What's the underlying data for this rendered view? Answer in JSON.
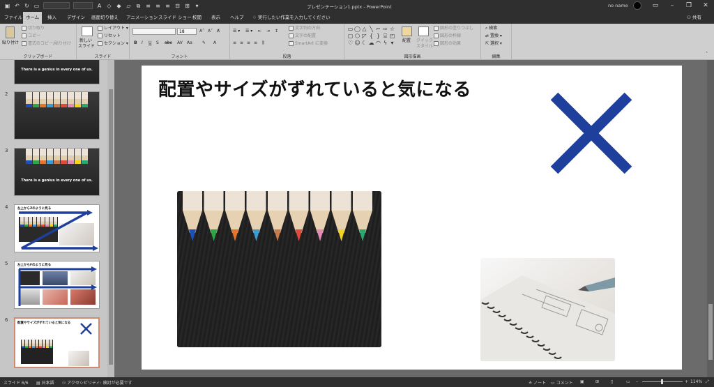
{
  "window": {
    "title": "プレゼンテーション1.pptx - PowerPoint",
    "user": "no name"
  },
  "tabs": [
    {
      "label": "ファイル",
      "active": false
    },
    {
      "label": "ホーム",
      "active": true
    },
    {
      "label": "挿入",
      "active": false
    },
    {
      "label": "デザイン",
      "active": false
    },
    {
      "label": "画面切り替え",
      "active": false
    },
    {
      "label": "アニメーション",
      "active": false
    },
    {
      "label": "スライド ショー",
      "active": false
    },
    {
      "label": "校閲",
      "active": false
    },
    {
      "label": "表示",
      "active": false
    },
    {
      "label": "ヘルプ",
      "active": false
    }
  ],
  "tell_me": "実行したい作業を入力してください",
  "share": "共有",
  "ribbon": {
    "clipboard": {
      "group_label": "クリップボード",
      "paste": "貼り付け",
      "cut": "切り取り",
      "copy": "コピー",
      "format_painter": "書式のコピー/貼り付け"
    },
    "slides": {
      "group_label": "スライド",
      "new_slide_line1": "新しい",
      "new_slide_line2": "スライド",
      "layout": "レイアウト",
      "reset": "リセット",
      "section": "セクション"
    },
    "font": {
      "group_label": "フォント",
      "size": "18",
      "bold": "B",
      "italic": "I",
      "underline": "U",
      "shadow": "S",
      "strike": "abc"
    },
    "paragraph": {
      "group_label": "段落",
      "text_direction": "文字列の方向",
      "align_text": "文字の配置",
      "smartart": "SmartArt に変換"
    },
    "drawing": {
      "group_label": "図形描画",
      "arrange": "配置",
      "quick_styles_line1": "クイック",
      "quick_styles_line2": "スタイル",
      "shape_fill": "図形の塗りつぶし",
      "shape_outline": "図形の枠線",
      "shape_effects": "図形の効果"
    },
    "editing": {
      "group_label": "編集",
      "find": "検索",
      "replace": "置換",
      "select": "選択"
    }
  },
  "thumbnails": [
    {
      "num": "",
      "caption": "There is a genius in every one of us."
    },
    {
      "num": "2",
      "caption": ""
    },
    {
      "num": "3",
      "caption": "There is a genius in every one of us."
    },
    {
      "num": "4",
      "caption": "左上からZのように見る"
    },
    {
      "num": "5",
      "caption": "左上からFのように見る"
    },
    {
      "num": "6",
      "caption": "配置やサイズがずれていると気になる"
    }
  ],
  "slide": {
    "title": "配置やサイズがずれていると気になる",
    "x_color": "#1e3f9c"
  },
  "status": {
    "slide_of": "スライド 6/6",
    "language": "日本語",
    "accessibility": "アクセシビリティ: 検討が必要です",
    "notes": "ノート",
    "comments": "コメント",
    "zoom": "114%"
  },
  "colors": {
    "ribbon_bg": "#cfcfcf",
    "titlebar_bg": "#2f2f2f",
    "pane_bg": "#c6c6c6",
    "editor_bg": "#6b6b6b",
    "accent_blue": "#1e3f9c",
    "selected_thumb_border": "#d08a72"
  },
  "pencil_tip_colors": [
    "#1d4fb8",
    "#2aa845",
    "#e8742a",
    "#3b9bd6",
    "#c87a4a",
    "#e04a3a",
    "#e38bb4",
    "#f3d41c",
    "#27a86e"
  ]
}
